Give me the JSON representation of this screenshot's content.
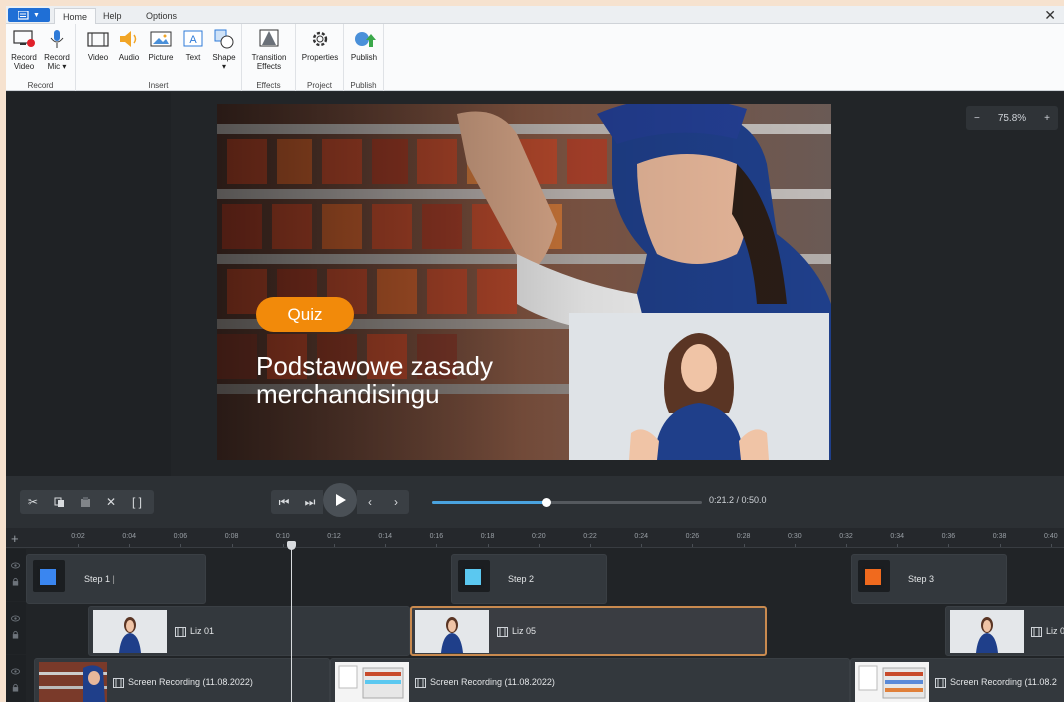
{
  "ribbon": {
    "app_menu_icon": "menu-icon",
    "tabs": [
      "Home",
      "Help",
      "Options"
    ],
    "active_tab": "Home",
    "groups": [
      {
        "label": "Record",
        "buttons": [
          "Record Video",
          "Record Mic ▾"
        ]
      },
      {
        "label": "Insert",
        "buttons": [
          "Video",
          "Audio",
          "Picture",
          "Text",
          "Shape ▾"
        ]
      },
      {
        "label": "Effects",
        "buttons": [
          "Transition Effects"
        ]
      },
      {
        "label": "Project",
        "buttons": [
          "Properties"
        ]
      },
      {
        "label": "Publish",
        "buttons": [
          "Publish"
        ]
      }
    ],
    "close_glyph": "✕"
  },
  "stage": {
    "zoom": {
      "minus": "−",
      "value": "75.8%",
      "plus": "+"
    },
    "slide": {
      "badge": "Quiz",
      "title": "Podstawowe zasady merchandisingu"
    }
  },
  "playback": {
    "time": "0:21.2 / 0:50.0",
    "progress": 0.424
  },
  "timeline": {
    "ticks": [
      "0:02",
      "0:04",
      "0:06",
      "0:08",
      "0:10",
      "0:12",
      "0:14",
      "0:16",
      "0:18",
      "0:20",
      "0:22",
      "0:24",
      "0:26",
      "0:28",
      "0:30",
      "0:32",
      "0:34",
      "0:36",
      "0:38",
      "0:40"
    ],
    "steps": [
      {
        "label": "Step 1",
        "color": "#3a86f0"
      },
      {
        "label": "Step 2",
        "color": "#5bc8f0"
      },
      {
        "label": "Step 3",
        "color": "#f06a1e"
      }
    ],
    "video_clips": [
      "Liz 01",
      "Liz 05",
      "Liz 0"
    ],
    "recordings": [
      "Screen Recording (11.08.2022)",
      "Screen Recording (11.08.2022)",
      "Screen Recording (11.08.2"
    ]
  },
  "colors": {
    "accent": "#1f6fd6",
    "quiz": "#f28a0a",
    "selection": "#c98a4f",
    "progress": "#4aa3df"
  }
}
